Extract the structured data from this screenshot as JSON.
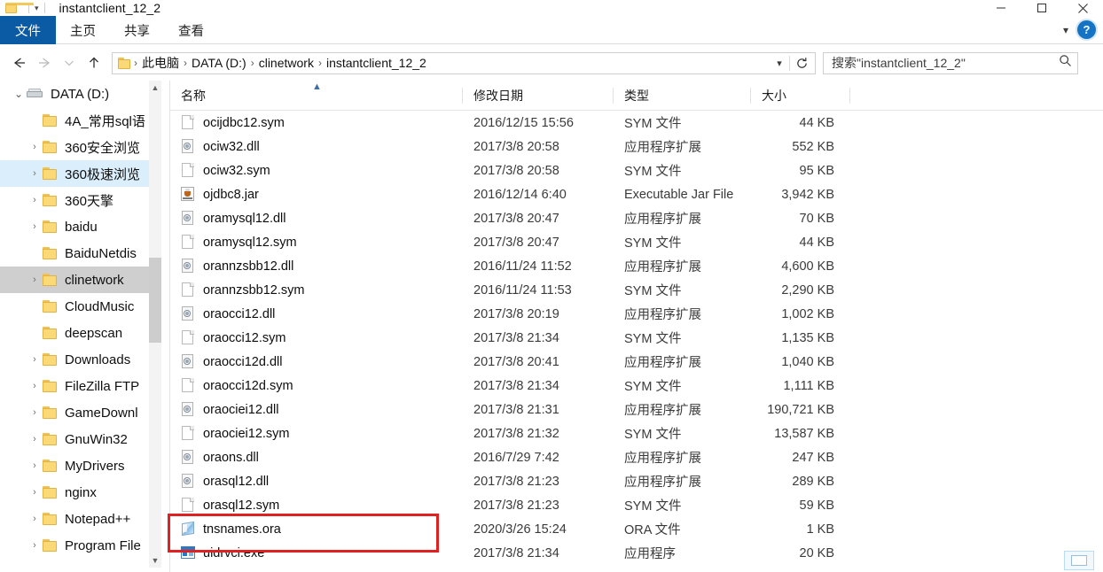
{
  "window": {
    "title": "instantclient_12_2",
    "quick_access": {
      "folder_icon": "folder-icon",
      "dropdown_icon": "chevron-down-icon"
    },
    "controls": {
      "minimize": "minimize-icon",
      "maximize": "maximize-icon",
      "close": "close-icon"
    }
  },
  "ribbon": {
    "tabs": [
      {
        "label": "文件",
        "active": true
      },
      {
        "label": "主页",
        "active": false
      },
      {
        "label": "共享",
        "active": false
      },
      {
        "label": "查看",
        "active": false
      }
    ],
    "expand_icon": "chevron-down-icon",
    "help_icon": "help-icon",
    "help_label": "?"
  },
  "navigation": {
    "back_icon": "arrow-left-icon",
    "forward_icon": "arrow-right-icon",
    "recent_icon": "chevron-down-icon",
    "up_icon": "arrow-up-icon",
    "refresh_icon": "refresh-icon",
    "address_dropdown_icon": "chevron-down-icon",
    "breadcrumb_icon": "folder-icon",
    "breadcrumb": [
      "此电脑",
      "DATA (D:)",
      "clinetwork",
      "instantclient_12_2"
    ],
    "separator": "›"
  },
  "search": {
    "placeholder": "搜索\"instantclient_12_2\"",
    "value": "",
    "icon": "search-icon"
  },
  "sidebar": {
    "scrollbar": {
      "up_icon": "chevron-up-icon",
      "down_icon": "chevron-down-icon"
    },
    "items": [
      {
        "label": "DATA (D:)",
        "icon": "drive-icon",
        "indent": 1,
        "expander": "chevron-down-icon",
        "state": "normal"
      },
      {
        "label": "4A_常用sql语",
        "icon": "folder-icon",
        "indent": 2,
        "expander": "",
        "state": "normal"
      },
      {
        "label": "360安全浏览",
        "icon": "folder-icon",
        "indent": 2,
        "expander": "chevron-right-icon",
        "state": "normal"
      },
      {
        "label": "360极速浏览",
        "icon": "folder-icon",
        "indent": 2,
        "expander": "chevron-right-icon",
        "state": "hover"
      },
      {
        "label": "360天擎",
        "icon": "folder-icon",
        "indent": 2,
        "expander": "chevron-right-icon",
        "state": "normal"
      },
      {
        "label": "baidu",
        "icon": "folder-icon",
        "indent": 2,
        "expander": "chevron-right-icon",
        "state": "normal"
      },
      {
        "label": "BaiduNetdis",
        "icon": "folder-icon",
        "indent": 2,
        "expander": "",
        "state": "normal"
      },
      {
        "label": "clinetwork",
        "icon": "folder-icon",
        "indent": 2,
        "expander": "chevron-right-icon",
        "state": "selected"
      },
      {
        "label": "CloudMusic",
        "icon": "folder-icon",
        "indent": 2,
        "expander": "",
        "state": "normal"
      },
      {
        "label": "deepscan",
        "icon": "folder-icon",
        "indent": 2,
        "expander": "",
        "state": "normal"
      },
      {
        "label": "Downloads",
        "icon": "folder-icon",
        "indent": 2,
        "expander": "chevron-right-icon",
        "state": "normal"
      },
      {
        "label": "FileZilla FTP",
        "icon": "folder-icon",
        "indent": 2,
        "expander": "chevron-right-icon",
        "state": "normal"
      },
      {
        "label": "GameDownl",
        "icon": "folder-icon",
        "indent": 2,
        "expander": "chevron-right-icon",
        "state": "normal"
      },
      {
        "label": "GnuWin32",
        "icon": "folder-icon",
        "indent": 2,
        "expander": "chevron-right-icon",
        "state": "normal"
      },
      {
        "label": "MyDrivers",
        "icon": "folder-icon",
        "indent": 2,
        "expander": "chevron-right-icon",
        "state": "normal"
      },
      {
        "label": "nginx",
        "icon": "folder-icon",
        "indent": 2,
        "expander": "chevron-right-icon",
        "state": "normal"
      },
      {
        "label": "Notepad++",
        "icon": "folder-icon",
        "indent": 2,
        "expander": "chevron-right-icon",
        "state": "normal"
      },
      {
        "label": "Program File",
        "icon": "folder-icon",
        "indent": 2,
        "expander": "chevron-right-icon",
        "state": "normal"
      }
    ]
  },
  "filelist": {
    "columns": [
      {
        "label": "名称",
        "key": "name",
        "sorted": "asc",
        "sort_icon": "sort-asc-icon"
      },
      {
        "label": "修改日期",
        "key": "date",
        "sorted": ""
      },
      {
        "label": "类型",
        "key": "type",
        "sorted": ""
      },
      {
        "label": "大小",
        "key": "size",
        "sorted": ""
      }
    ],
    "rows": [
      {
        "name": "ocijdbc12.sym",
        "date": "2016/12/15 15:56",
        "type": "SYM 文件",
        "size": "44 KB",
        "icon": "sym-file-icon"
      },
      {
        "name": "ociw32.dll",
        "date": "2017/3/8 20:58",
        "type": "应用程序扩展",
        "size": "552 KB",
        "icon": "dll-file-icon"
      },
      {
        "name": "ociw32.sym",
        "date": "2017/3/8 20:58",
        "type": "SYM 文件",
        "size": "95 KB",
        "icon": "sym-file-icon"
      },
      {
        "name": "ojdbc8.jar",
        "date": "2016/12/14 6:40",
        "type": "Executable Jar File",
        "size": "3,942 KB",
        "icon": "jar-file-icon"
      },
      {
        "name": "oramysql12.dll",
        "date": "2017/3/8 20:47",
        "type": "应用程序扩展",
        "size": "70 KB",
        "icon": "dll-file-icon"
      },
      {
        "name": "oramysql12.sym",
        "date": "2017/3/8 20:47",
        "type": "SYM 文件",
        "size": "44 KB",
        "icon": "sym-file-icon"
      },
      {
        "name": "orannzsbb12.dll",
        "date": "2016/11/24 11:52",
        "type": "应用程序扩展",
        "size": "4,600 KB",
        "icon": "dll-file-icon"
      },
      {
        "name": "orannzsbb12.sym",
        "date": "2016/11/24 11:53",
        "type": "SYM 文件",
        "size": "2,290 KB",
        "icon": "sym-file-icon"
      },
      {
        "name": "oraocci12.dll",
        "date": "2017/3/8 20:19",
        "type": "应用程序扩展",
        "size": "1,002 KB",
        "icon": "dll-file-icon"
      },
      {
        "name": "oraocci12.sym",
        "date": "2017/3/8 21:34",
        "type": "SYM 文件",
        "size": "1,135 KB",
        "icon": "sym-file-icon"
      },
      {
        "name": "oraocci12d.dll",
        "date": "2017/3/8 20:41",
        "type": "应用程序扩展",
        "size": "1,040 KB",
        "icon": "dll-file-icon"
      },
      {
        "name": "oraocci12d.sym",
        "date": "2017/3/8 21:34",
        "type": "SYM 文件",
        "size": "1,111 KB",
        "icon": "sym-file-icon"
      },
      {
        "name": "oraociei12.dll",
        "date": "2017/3/8 21:31",
        "type": "应用程序扩展",
        "size": "190,721 KB",
        "icon": "dll-file-icon"
      },
      {
        "name": "oraociei12.sym",
        "date": "2017/3/8 21:32",
        "type": "SYM 文件",
        "size": "13,587 KB",
        "icon": "sym-file-icon"
      },
      {
        "name": "oraons.dll",
        "date": "2016/7/29 7:42",
        "type": "应用程序扩展",
        "size": "247 KB",
        "icon": "dll-file-icon"
      },
      {
        "name": "orasql12.dll",
        "date": "2017/3/8 21:23",
        "type": "应用程序扩展",
        "size": "289 KB",
        "icon": "dll-file-icon"
      },
      {
        "name": "orasql12.sym",
        "date": "2017/3/8 21:23",
        "type": "SYM 文件",
        "size": "59 KB",
        "icon": "sym-file-icon"
      },
      {
        "name": "tnsnames.ora",
        "date": "2020/3/26 15:24",
        "type": "ORA 文件",
        "size": "1 KB",
        "icon": "ora-file-icon"
      },
      {
        "name": "uidrvci.exe",
        "date": "2017/3/8 21:34",
        "type": "应用程序",
        "size": "20 KB",
        "icon": "exe-file-icon"
      }
    ]
  },
  "annotation": {
    "color": "#e02121",
    "target": "tnsnames.ora",
    "shape": "rectangle"
  },
  "statusbar": {
    "view_button_icon": "details-view-icon"
  }
}
